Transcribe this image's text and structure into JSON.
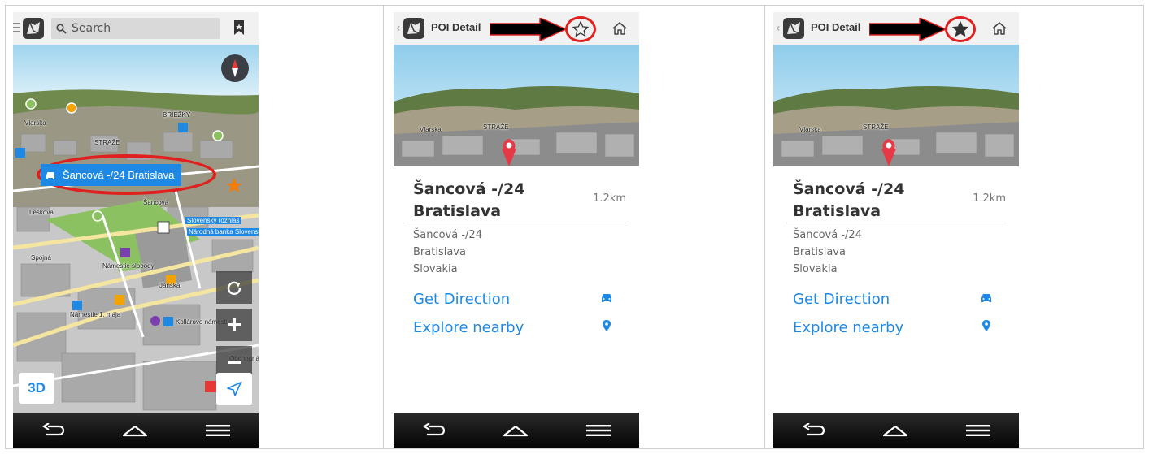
{
  "phone_map": {
    "search_placeholder": "Search",
    "callout_label": "Šancová -/24  Bratislava",
    "view_mode_label": "3D",
    "map_labels": [
      "Vlarska",
      "STRAŽE",
      "BRIEŽKY",
      "Šancová",
      "Lešková",
      "Spojná",
      "Námestie slobody",
      "Jánska",
      "Námestie 1. mája",
      "Kollárovo námestie",
      "Slovenský rozhlas",
      "Národná banka Slovenska",
      "Obchodná"
    ]
  },
  "phone_poi_unstarred": {
    "title": "POI Detail",
    "name_line1": "Šancová -/24",
    "name_line2": "Bratislava",
    "distance": "1.2km",
    "address_line1": "Šancová -/24",
    "address_line2": "Bratislava",
    "address_line3": "Slovakia",
    "get_direction_label": "Get Direction",
    "explore_nearby_label": "Explore nearby",
    "favorite_state": "unfavorited",
    "image_labels": [
      "Vlarska",
      "STRAŽE"
    ]
  },
  "phone_poi_starred": {
    "title": "POI Detail",
    "name_line1": "Šancová -/24",
    "name_line2": "Bratislava",
    "distance": "1.2km",
    "address_line1": "Šancová -/24",
    "address_line2": "Bratislava",
    "address_line3": "Slovakia",
    "get_direction_label": "Get Direction",
    "explore_nearby_label": "Explore nearby",
    "favorite_state": "favorited",
    "image_labels": [
      "Vlarska",
      "STRAŽE"
    ]
  },
  "colors": {
    "accent_blue": "#1e88e5",
    "highlight_red": "#e0201e",
    "topbar_bg": "#f1f1f1",
    "navbar_bg": "#0a0a0a"
  },
  "icons": {
    "map_topbar": [
      "menu-icon",
      "app-logo-icon",
      "search-icon",
      "bookmark-icon"
    ],
    "map_controls": [
      "compass-icon",
      "rotate-icon",
      "zoom-in-icon",
      "zoom-out-icon",
      "locate-arrow-icon"
    ],
    "poi_topbar": [
      "back-chevron-icon",
      "app-logo-icon",
      "star-icon",
      "home-icon"
    ],
    "poi_actions": [
      "car-icon",
      "pin-icon"
    ],
    "navbar": [
      "back-icon",
      "home-icon",
      "menu-icon"
    ]
  }
}
